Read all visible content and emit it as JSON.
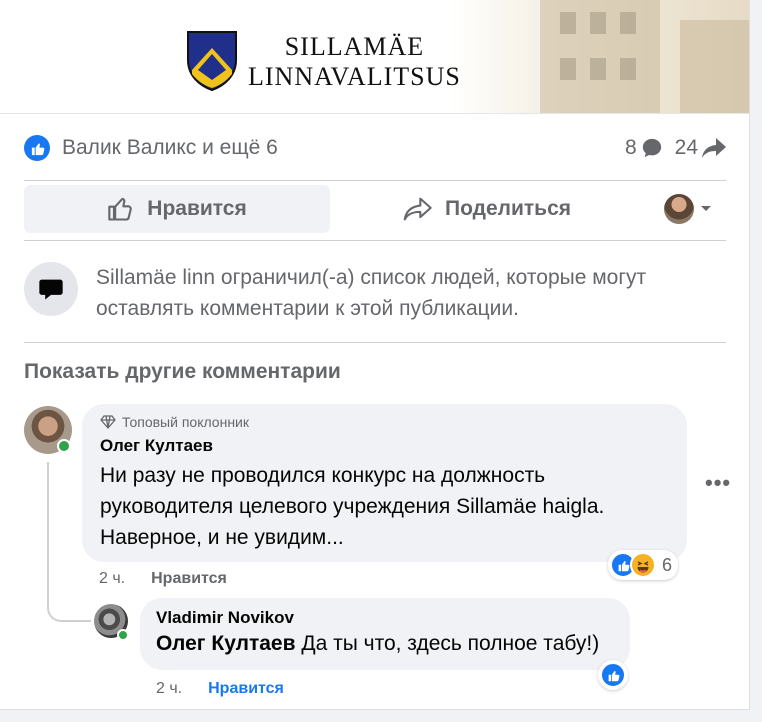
{
  "banner": {
    "org_line1": "SILLAMÄE",
    "org_line2": "LINNAVALITSUS"
  },
  "stats": {
    "reactors_text": "Валик Валикс и ещё 6",
    "comments_count": "8",
    "shares_count": "24"
  },
  "actions": {
    "like_label": "Нравится",
    "share_label": "Поделиться"
  },
  "restriction": {
    "text": "Sillamäe linn ограничил(-а) список людей, которые могут оставлять комментарии к этой публикации."
  },
  "comments_section": {
    "more_label": "Показать другие комментарии"
  },
  "comments": [
    {
      "badge": "Топовый поклонник",
      "author": "Олег Култаев",
      "text": "Ни разу не проводился конкурс на должность руководителя целевого учреждения Sillamäe haigla. Наверное, и не увидим...",
      "time": "2 ч.",
      "like_label": "Нравится",
      "reaction_count": "6",
      "reactions": [
        "like-icon",
        "haha-icon"
      ]
    }
  ],
  "replies": [
    {
      "author": "Vladimir Novikov",
      "mention": "Олег Култаев",
      "text": "Да ты что, здесь полное табу!)",
      "time": "2 ч.",
      "like_label": "Нравится",
      "reactions": [
        "like-icon"
      ]
    }
  ],
  "colors": {
    "brand_blue": "#1877f2",
    "muted_text": "#65676b",
    "bubble_bg": "#f0f2f5",
    "online_green": "#31a24c"
  }
}
